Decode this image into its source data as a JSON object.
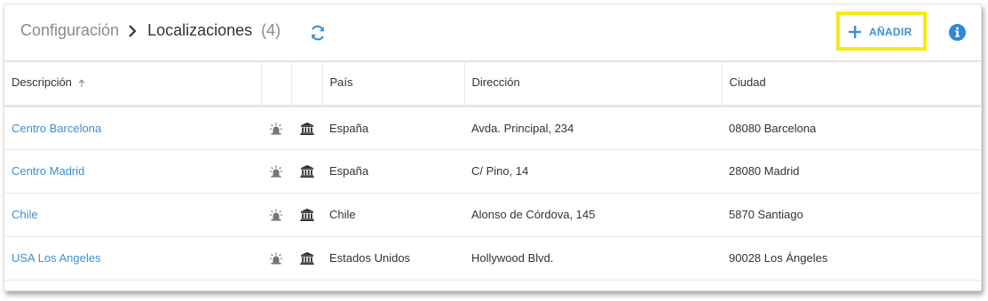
{
  "breadcrumb": {
    "parent": "Configuración",
    "current": "Localizaciones",
    "count": "(4)"
  },
  "toolbar": {
    "add_label": "AÑADIR",
    "add_icon": "plus-icon",
    "refresh_icon": "refresh-icon",
    "info_icon": "info-icon"
  },
  "colors": {
    "accent": "#3d8fd1",
    "highlight": "#f5eb1a"
  },
  "table": {
    "columns": [
      "Descripción",
      "",
      "",
      "País",
      "Dirección",
      "Ciudad"
    ],
    "sort_icon": "sort-ascending-icon",
    "rows": [
      {
        "descripcion": "Centro Barcelona",
        "pais": "España",
        "direccion": "Avda. Principal, 234",
        "ciudad": "08080 Barcelona",
        "icon1": "siren-icon",
        "icon2": "building-icon"
      },
      {
        "descripcion": "Centro Madrid",
        "pais": "España",
        "direccion": "C/ Pino, 14",
        "ciudad": "28080 Madrid",
        "icon1": "siren-icon",
        "icon2": "building-icon"
      },
      {
        "descripcion": "Chile",
        "pais": "Chile",
        "direccion": "Alonso de Córdova, 145",
        "ciudad": "5870 Santiago",
        "icon1": "siren-icon",
        "icon2": "building-icon"
      },
      {
        "descripcion": "USA Los Angeles",
        "pais": "Estados Unidos",
        "direccion": "Hollywood Blvd.",
        "ciudad": "90028 Los Ángeles",
        "icon1": "siren-icon",
        "icon2": "building-icon"
      }
    ]
  }
}
